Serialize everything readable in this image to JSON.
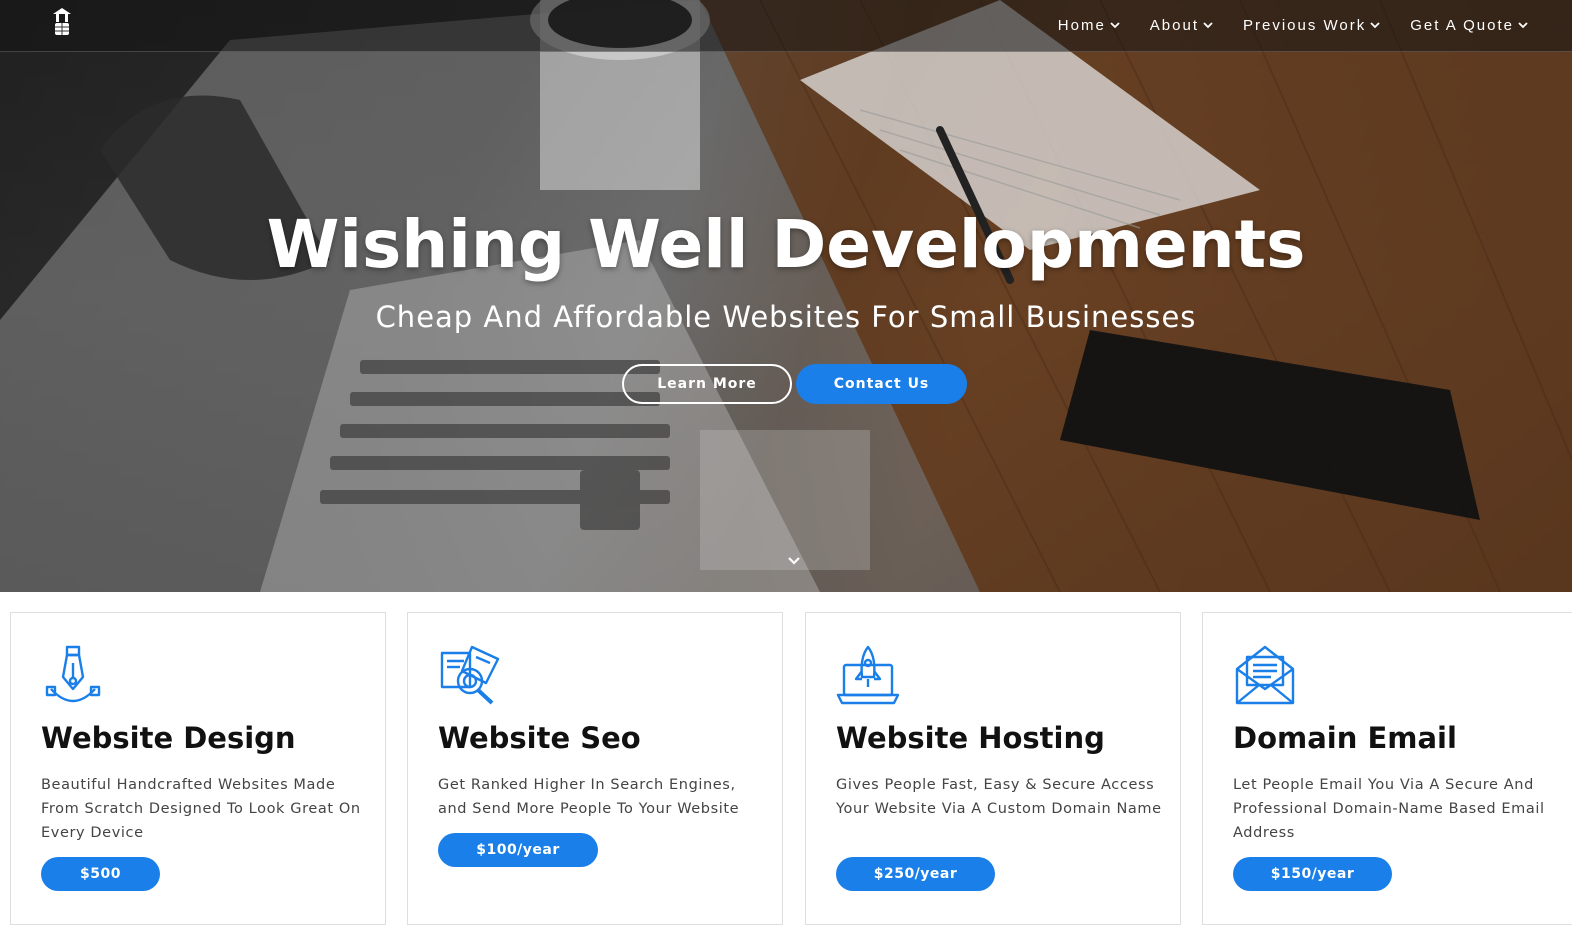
{
  "nav": {
    "items": [
      {
        "label": "Home"
      },
      {
        "label": "About"
      },
      {
        "label": "Previous Work"
      },
      {
        "label": "Get A Quote"
      }
    ]
  },
  "hero": {
    "title": "Wishing Well Developments",
    "subtitle": "Cheap And Affordable Websites For Small Businesses",
    "learn_more_label": "Learn More",
    "contact_label": "Contact Us"
  },
  "services": [
    {
      "icon": "pen-tool-icon",
      "title": "Website Design",
      "description": "Beautiful Handcrafted Websites Made From Scratch Designed To Look Great On Every Device",
      "price": "$500"
    },
    {
      "icon": "seo-search-icon",
      "title": "Website Seo",
      "description": "Get Ranked Higher In Search Engines, and Send More People To Your Website",
      "price": "$100/year"
    },
    {
      "icon": "rocket-laptop-icon",
      "title": "Website Hosting",
      "description": "Gives People Fast, Easy & Secure Access Your Website Via A Custom Domain Name",
      "price": "$250/year"
    },
    {
      "icon": "envelope-icon",
      "title": "Domain Email",
      "description": "Let People Email You Via A Secure And Professional Domain-Name Based Email Address",
      "price": "$150/year"
    }
  ],
  "colors": {
    "accent": "#1a7fe8",
    "text_dark": "#111111",
    "text_body": "#444444"
  }
}
